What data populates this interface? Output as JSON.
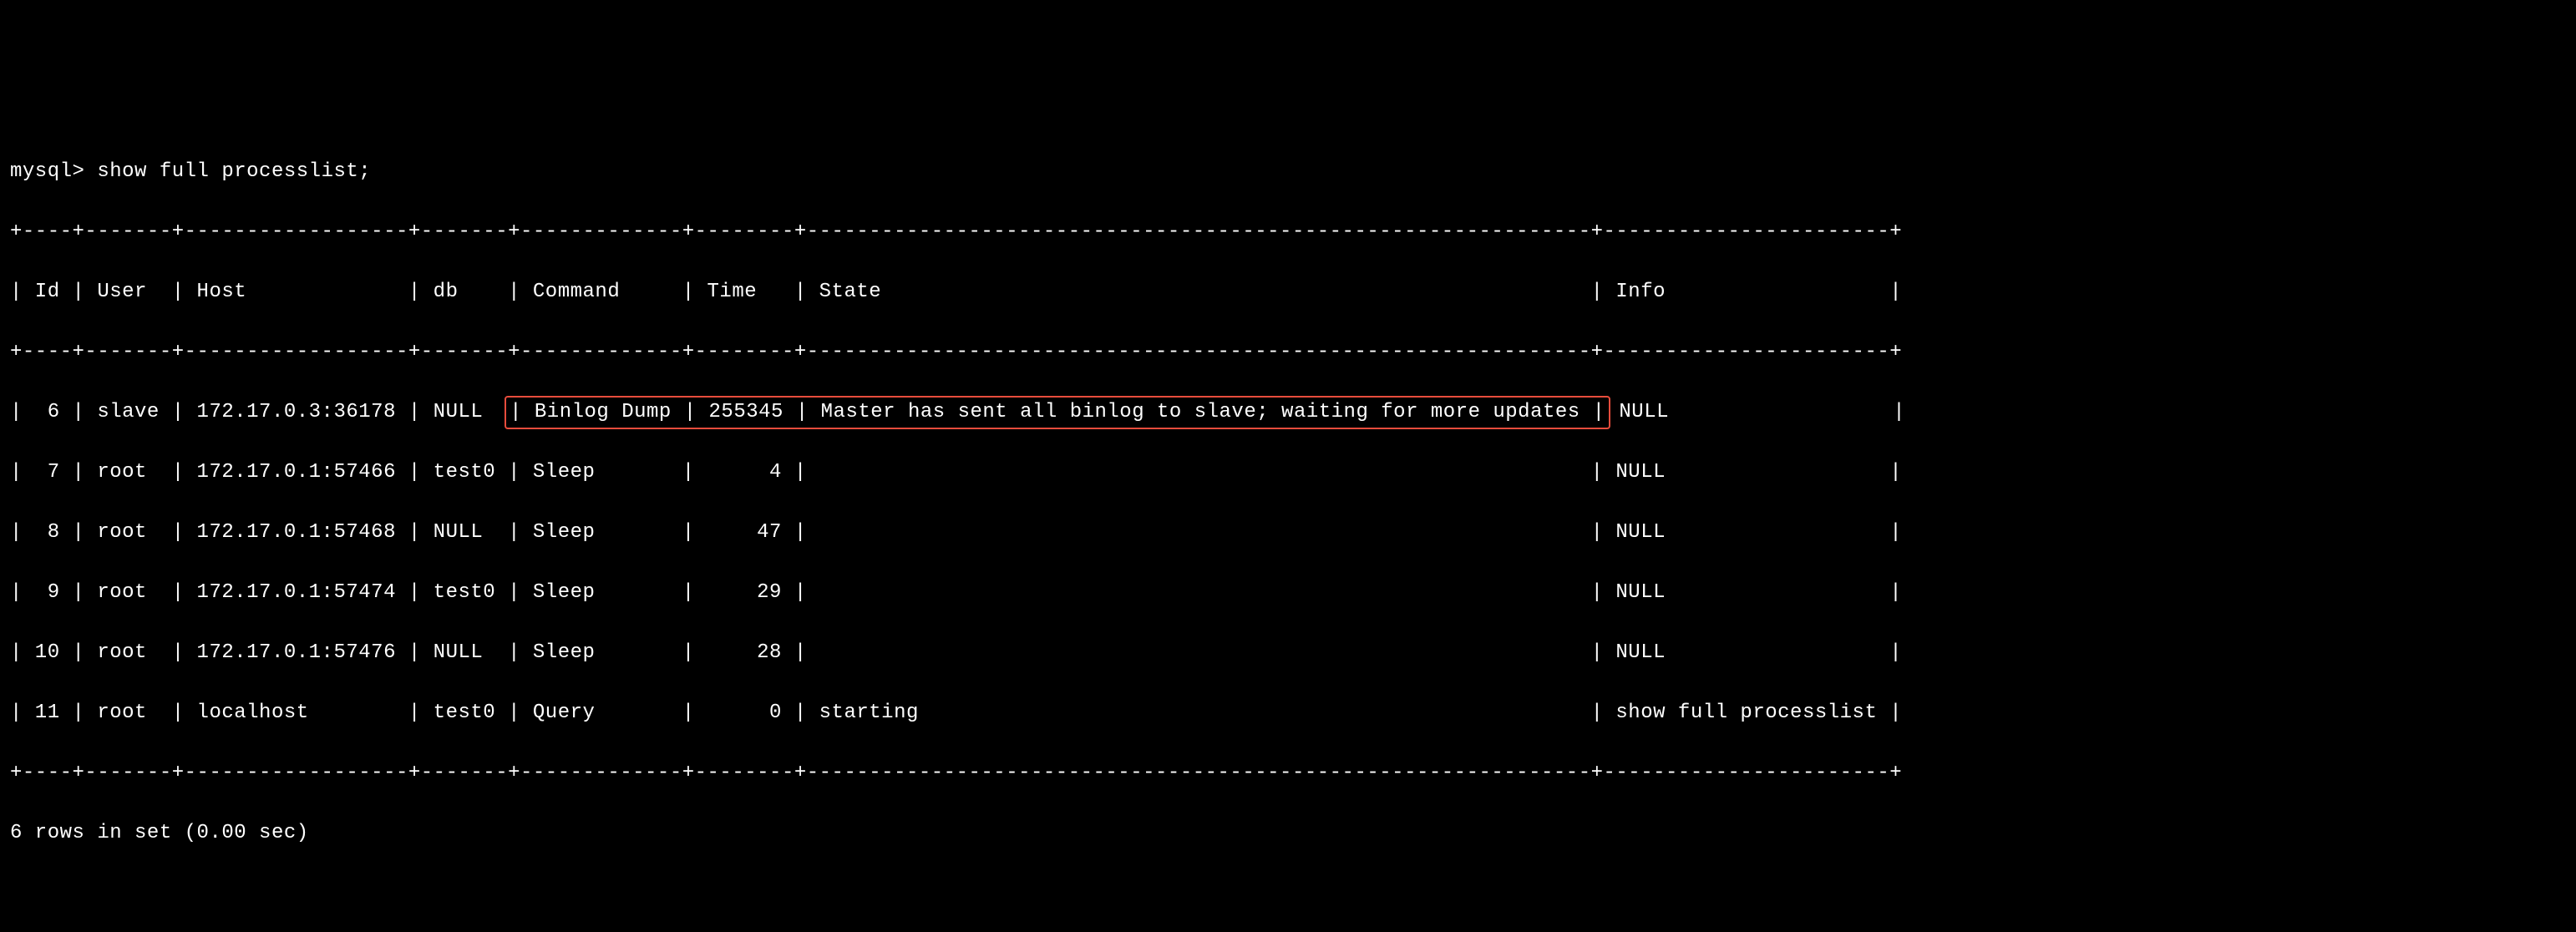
{
  "prompt": "mysql>",
  "command": "show full processlist;",
  "table": {
    "top_border": "+----+-------+------------------+-------+-------------+--------+---------------------------------------------------------------+-----------------------+",
    "header_line": "| Id | User  | Host             | db    | Command     | Time   | State                                                         | Info                  |",
    "mid_border": "+----+-------+------------------+-------+-------------+--------+---------------------------------------------------------------+-----------------------+",
    "rows": [
      {
        "prefix": "|  6 | slave | 172.17.0.3:36178 | NULL  ",
        "highlighted": "| Binlog Dump | 255345 | Master has sent all binlog to slave; waiting for more updates |",
        "suffix": " NULL                  |"
      },
      {
        "full": "|  7 | root  | 172.17.0.1:57466 | test0 | Sleep       |      4 |                                                               | NULL                  |"
      },
      {
        "full": "|  8 | root  | 172.17.0.1:57468 | NULL  | Sleep       |     47 |                                                               | NULL                  |"
      },
      {
        "full": "|  9 | root  | 172.17.0.1:57474 | test0 | Sleep       |     29 |                                                               | NULL                  |"
      },
      {
        "full": "| 10 | root  | 172.17.0.1:57476 | NULL  | Sleep       |     28 |                                                               | NULL                  |"
      },
      {
        "full": "| 11 | root  | localhost        | test0 | Query       |      0 | starting                                                      | show full processlist |"
      }
    ],
    "bottom_border": "+----+-------+------------------+-------+-------------+--------+---------------------------------------------------------------+-----------------------+"
  },
  "footer": "6 rows in set (0.00 sec)",
  "chart_data": {
    "type": "table",
    "title": "MySQL show full processlist",
    "columns": [
      "Id",
      "User",
      "Host",
      "db",
      "Command",
      "Time",
      "State",
      "Info"
    ],
    "rows": [
      {
        "Id": 6,
        "User": "slave",
        "Host": "172.17.0.3:36178",
        "db": "NULL",
        "Command": "Binlog Dump",
        "Time": 255345,
        "State": "Master has sent all binlog to slave; waiting for more updates",
        "Info": "NULL"
      },
      {
        "Id": 7,
        "User": "root",
        "Host": "172.17.0.1:57466",
        "db": "test0",
        "Command": "Sleep",
        "Time": 4,
        "State": "",
        "Info": "NULL"
      },
      {
        "Id": 8,
        "User": "root",
        "Host": "172.17.0.1:57468",
        "db": "NULL",
        "Command": "Sleep",
        "Time": 47,
        "State": "",
        "Info": "NULL"
      },
      {
        "Id": 9,
        "User": "root",
        "Host": "172.17.0.1:57474",
        "db": "test0",
        "Command": "Sleep",
        "Time": 29,
        "State": "",
        "Info": "NULL"
      },
      {
        "Id": 10,
        "User": "root",
        "Host": "172.17.0.1:57476",
        "db": "NULL",
        "Command": "Sleep",
        "Time": 28,
        "State": "",
        "Info": "NULL"
      },
      {
        "Id": 11,
        "User": "root",
        "Host": "localhost",
        "db": "test0",
        "Command": "Query",
        "Time": 0,
        "State": "starting",
        "Info": "show full processlist"
      }
    ],
    "summary": "6 rows in set (0.00 sec)"
  }
}
